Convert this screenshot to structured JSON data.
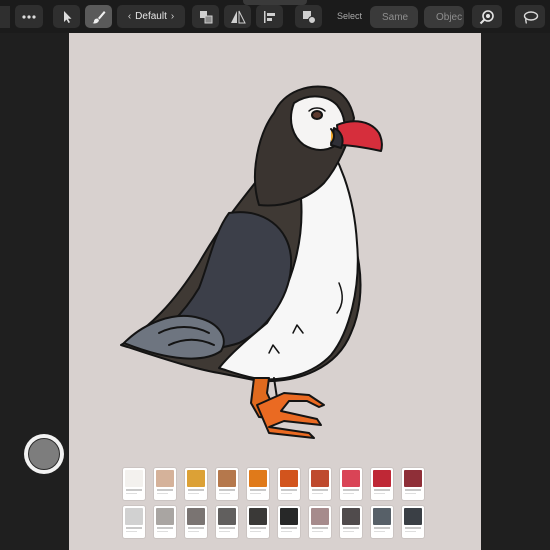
{
  "toolbar": {
    "style_name": "Default",
    "select_label": "Select",
    "same_button": "Same",
    "object_button": "Objec",
    "icons": [
      "menu-icon",
      "more-icon",
      "move-tool-icon",
      "brush-tool-icon",
      "chevron-left-icon",
      "chevron-right-icon",
      "arrange-icon",
      "flip-icon",
      "align-icon",
      "boolean-icon",
      "zoom-icon",
      "lasso-icon"
    ]
  },
  "canvas": {
    "background_color": "#d8d1cf",
    "subject": "puffin-illustration"
  },
  "swatches": {
    "rows": [
      [
        "#f3f1ee",
        "#d5b29a",
        "#dca136",
        "#b5784c",
        "#e07a1a",
        "#d2541d",
        "#bf4a2e",
        "#d94456",
        "#bf2836",
        "#8f2f38"
      ],
      [
        "#d1d1d1",
        "#a9a5a2",
        "#7a7472",
        "#615f5e",
        "#3a3937",
        "#272828",
        "#a68b8c",
        "#504b4c",
        "#576068",
        "#3a3f45"
      ]
    ]
  },
  "shutter": {
    "state": "idle"
  }
}
